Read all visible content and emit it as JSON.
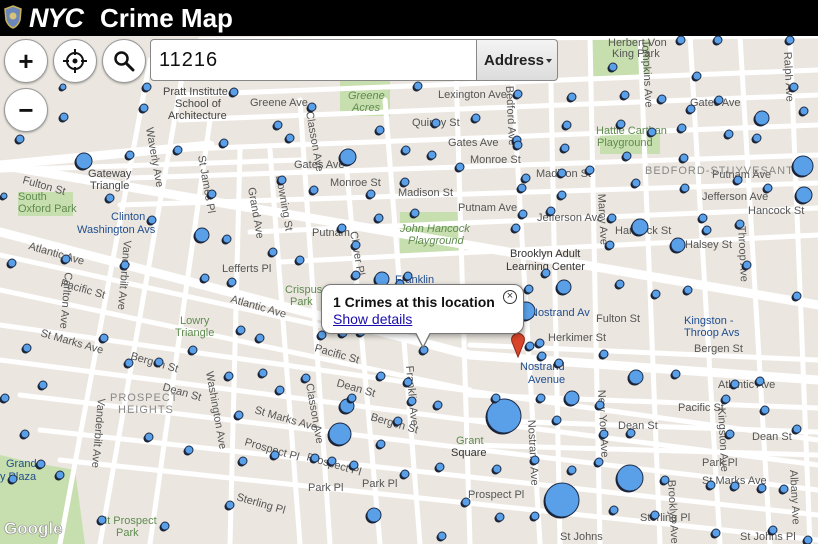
{
  "header": {
    "logo_text": "NYC",
    "title": "Crime Map"
  },
  "controls": {
    "zoom_in_label": "+",
    "zoom_out_label": "−"
  },
  "search": {
    "value": "11216",
    "type_label": "Address"
  },
  "popup": {
    "title": "1 Crimes at this location",
    "link_label": "Show details",
    "close_label": "×"
  },
  "map": {
    "attribution": "Google",
    "colors": {
      "marker_fill": "#5aa0e8",
      "marker_stroke": "#1c2b47",
      "pin": "#d9452b",
      "park": "#c7dfae",
      "street": "#ffffff",
      "land": "#ebe7e0"
    },
    "labels": {
      "herbert_von_king_1": "Herbert Von",
      "herbert_von_king_2": "King Park",
      "pratt_1": "Pratt Institute",
      "pratt_2": "School of",
      "pratt_3": "Architecture",
      "greene_acres_1": "Greene",
      "greene_acres_2": "Acres",
      "greene_ave": "Greene Ave",
      "lexington_ave": "Lexington Ave",
      "quincy_st": "Quincy St",
      "gates_ave_east": "Gates Ave",
      "gates_ave_west": "Gates Ave",
      "gates_ave_top": "Gates Ave",
      "monroe_st_west": "Monroe St",
      "monroe_st_east": "Monroe St",
      "madison_st_west": "Madison St",
      "madison_st_east": "Madison St",
      "putnam_ave_west": "Putnam",
      "putnam_ave_mid": "Putnam Ave",
      "putnam_ave_east": "Putnam Ave",
      "jefferson_ave_mid": "Jefferson Ave",
      "jefferson_ave_east": "Jefferson Ave",
      "hancock_st_mid": "Hancock St",
      "hancock_st_east": "Hancock St",
      "halsey_st": "Halsey St",
      "hattie_carthan_1": "Hattie Carthan",
      "hattie_carthan_2": "Playground",
      "bedford_stuyvesant": "BEDFORD-STUYVESANT",
      "gateway_triangle_1": "Gateway",
      "gateway_triangle_2": "Triangle",
      "fulton_st_west": "Fulton St",
      "fulton_st_east": "Fulton St",
      "south_oxford_park_1": "South",
      "south_oxford_park_2": "Oxford Park",
      "clinton_washington_1": "Clinton -",
      "clinton_washington_2": "Washington Avs",
      "john_hancock_1": "John Hancock",
      "john_hancock_2": "Playground",
      "brooklyn_adult_1": "Brooklyn Adult",
      "brooklyn_adult_2": "Learning Center",
      "atlantic_ave_west": "Atlantic Ave",
      "atlantic_ave_mid": "Atlantic Ave",
      "atlantic_ave_east": "Atlantic Ave",
      "lefferts_pl": "Lefferts Pl",
      "crispus_1": "Crispus",
      "crispus_2": "Park",
      "franklin_ave_top": "Franklin",
      "nostrand_ave_top": "Nostrand Av",
      "herkimer_st": "Herkimer St",
      "nostrand_avenue_1": "Nostrand",
      "nostrand_avenue_2": "Avenue",
      "kingston_throop_1": "Kingston -",
      "kingston_throop_2": "Throop Avs",
      "lowry_triangle_1": "Lowry",
      "lowry_triangle_2": "Triangle",
      "pacific_st_west": "Pacific St",
      "pacific_st_mid": "Pacific St",
      "pacific_st_east": "Pacific St",
      "bergen_st_west": "Bergen St",
      "bergen_st_mid": "Bergen St",
      "bergen_st_east": "Bergen St",
      "st_marks_ave_west": "St Marks Ave",
      "st_marks_ave_mid": "St Marks Ave",
      "st_marks_ave_east": "St Marks Ave",
      "dean_st_west": "Dean St",
      "dean_st_mid": "Dean St",
      "dean_st_east": "Dean St",
      "dean_st_far": "Dean St",
      "prospect_heights_1": "PROSPECT",
      "prospect_heights_2": "HEIGHTS",
      "prospect_pl_west": "Prospect Pl",
      "prospect_pl_mid": "Prospect Pl",
      "prospect_pl_east": "Prospect Pl",
      "grand_army_1": "Grand",
      "grand_army_2": "y Plaza",
      "grant_square_1": "Grant",
      "grant_square_2": "Square",
      "park_pl_west": "Park Pl",
      "park_pl_mid": "Park Pl",
      "park_pl_east": "Park Pl",
      "sterling_pl": "Sterling Pl",
      "mt_prospect_park_1": "Mt Prospect",
      "mt_prospect_park_2": "Park",
      "sterling_pl_east": "Sterling Pl",
      "st_johns_pl": "St Johns",
      "st_johns_pl_east": "St Johns Pl",
      "waverly_ave": "Waverly Ave",
      "st_james_pl": "St James Pl",
      "grand_ave": "Grand Ave",
      "downing_st": "Downing St",
      "classon_ave_top": "Classon Ave",
      "claver_pl": "Claver Pl",
      "vanderbilt_ave_top": "Vanderbilt Ave",
      "vanderbilt_ave_bot": "Vanderbilt Ave",
      "carlton_ave": "Carlton Ave",
      "underhill_ave": "Underhill Ave",
      "washington_ave": "Washington Ave",
      "classon_ave_bot": "Classon Ave",
      "franklin_ave_bot": "Franklin Ave",
      "nostrand_ave_right": "Nostrand Ave",
      "new_york_ave": "New York Ave",
      "brooklyn_ave": "Brooklyn Ave",
      "kingston_ave": "Kingston Ave",
      "albany_ave": "Albany Ave",
      "marcy_ave": "Marcy Ave",
      "tompkins_ave": "Tompkins Ave",
      "throop_ave": "Throop Ave",
      "bedford_ave": "Bedford Ave",
      "stuyvesant_ave": "Stuyvesant Ave",
      "ralph_ave": "Ralph Ave",
      "sumner_ave": "Tompkins Ave"
    }
  }
}
